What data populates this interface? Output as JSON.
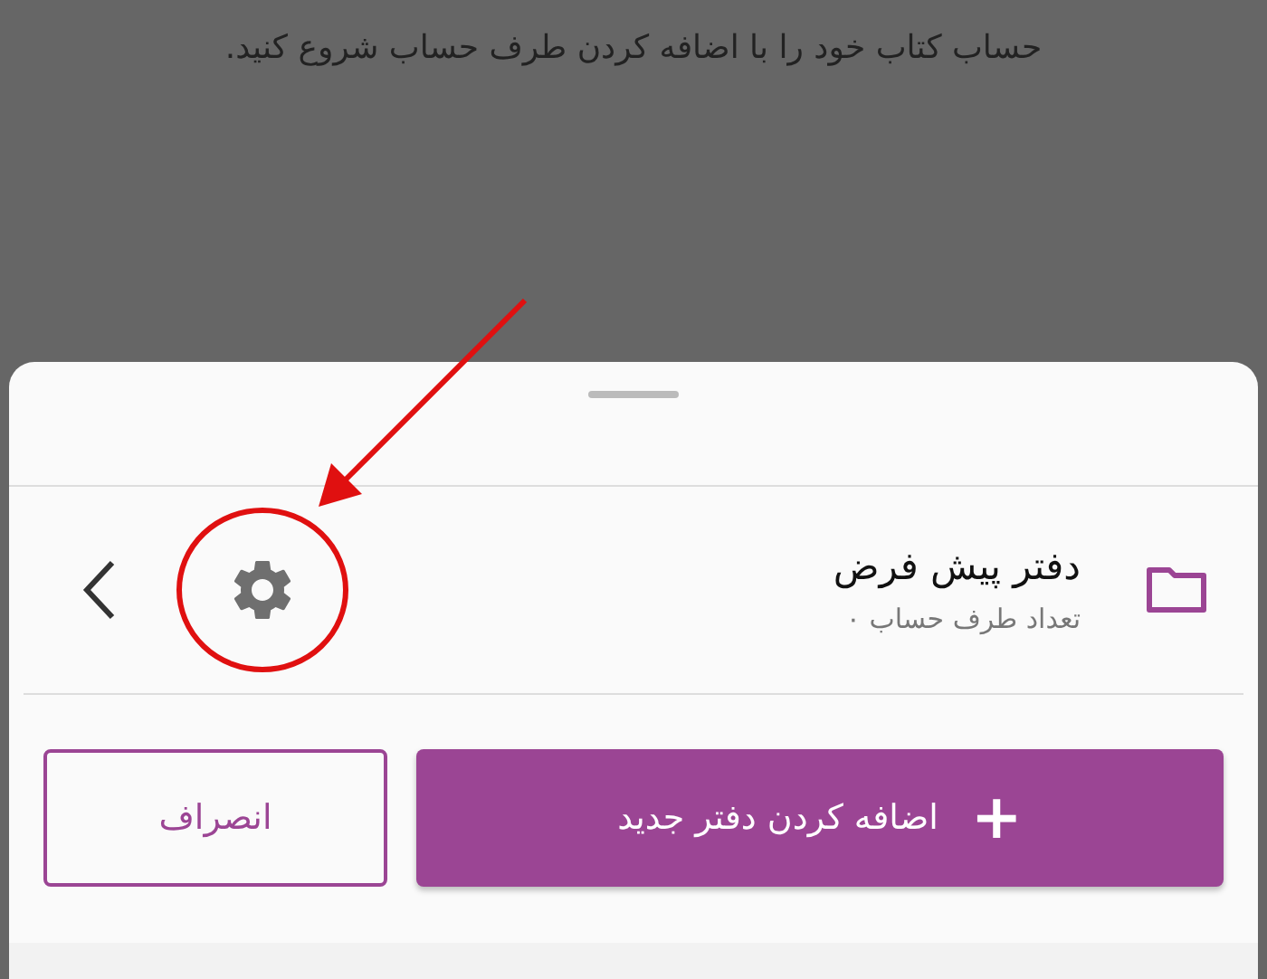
{
  "background_message": "حساب کتاب خود را با اضافه کردن طرف حساب شروع کنید.",
  "ledger": {
    "title": "دفتر پیش فرض",
    "subtitle": "تعداد طرف حساب ۰"
  },
  "buttons": [
    {
      "kind": "primary",
      "label": "اضافه کردن دفتر جدید",
      "icon": "+"
    },
    {
      "kind": "outline",
      "label": "انصراف"
    }
  ]
}
